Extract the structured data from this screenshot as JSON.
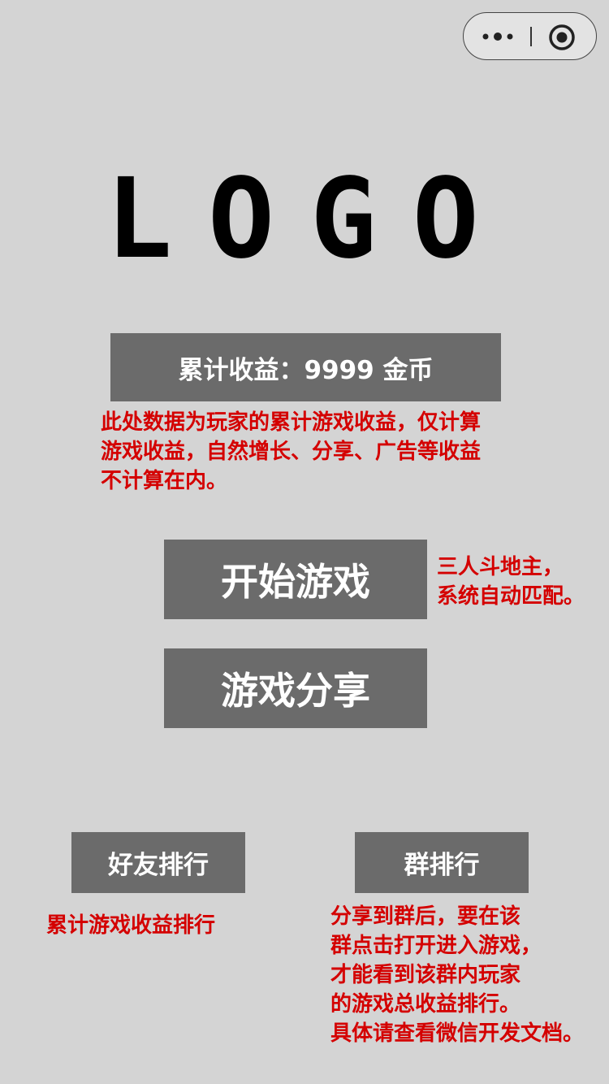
{
  "capsule": {
    "more_icon": "more-dots-icon",
    "close_icon": "target-circle-icon"
  },
  "logo": {
    "letters": [
      "L",
      "O",
      "G",
      "O"
    ]
  },
  "earnings": {
    "label": "累计收益：9999  金币"
  },
  "earnings_note": {
    "lines": [
      "此处数据为玩家的累计游戏收益，仅计算",
      "游戏收益，自然增长、分享、广告等收益",
      "不计算在内。"
    ]
  },
  "buttons": {
    "start_game": "开始游戏",
    "share_game": "游戏分享",
    "friends_rank": "好友排行",
    "group_rank": "群排行"
  },
  "start_note": {
    "lines": [
      "三人斗地主，",
      "系统自动匹配。"
    ]
  },
  "friends_note": {
    "lines": [
      "累计游戏收益排行"
    ]
  },
  "group_note": {
    "lines": [
      "分享到群后，要在该",
      "群点击打开进入游戏，",
      "才能看到该群内玩家",
      "的游戏总收益排行。",
      "具体请查看微信开发文档。"
    ]
  },
  "colors": {
    "background": "#d4d4d4",
    "button": "#6b6b6b",
    "note_text": "#d40000"
  }
}
